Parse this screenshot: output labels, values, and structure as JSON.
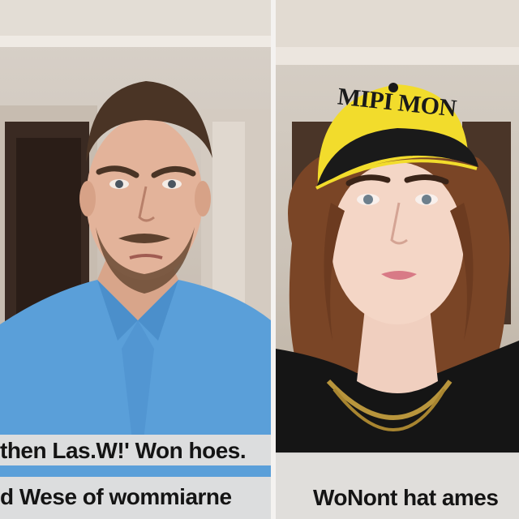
{
  "left_panel": {
    "caption_line1": "then Las.W!' Won hoes.",
    "caption_line2": "d Wese of wommiarne"
  },
  "right_panel": {
    "cap_text": "MIPI MON",
    "caption_line1": "WoNont hat ames"
  },
  "colors": {
    "shirt": "#5a9fd9",
    "cap_yellow": "#f2dc2c",
    "cap_black": "#1a1a1a",
    "hair": "#7a4526",
    "caption_bg": "#e2e0de"
  }
}
